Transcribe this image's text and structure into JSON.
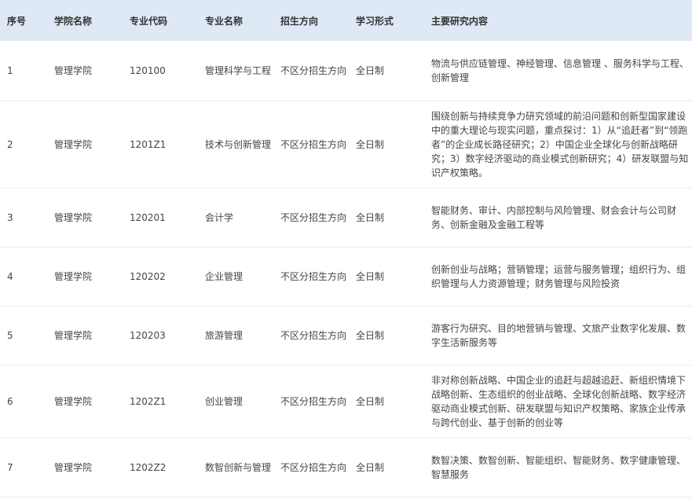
{
  "table": {
    "headers": [
      "序号",
      "学院名称",
      "专业代码",
      "专业名称",
      "招生方向",
      "学习形式",
      "主要研究内容"
    ],
    "rows": [
      [
        "1",
        "管理学院",
        "120100",
        "管理科学与工程",
        "不区分招生方向",
        "全日制",
        "物流与供应链管理、神经管理、信息管理 、服务科学与工程、创新管理"
      ],
      [
        "2",
        "管理学院",
        "1201Z1",
        "技术与创新管理",
        "不区分招生方向",
        "全日制",
        "围绕创新与持续竞争力研究领域的前沿问题和创新型国家建设中的重大理论与现实问题，重点探讨：1）从“追赶者”到“领跑者”的企业成长路径研究；2）中国企业全球化与创新战略研究；3）数字经济驱动的商业模式创新研究；4）研发联盟与知识产权策略。"
      ],
      [
        "3",
        "管理学院",
        "120201",
        "会计学",
        "不区分招生方向",
        "全日制",
        "智能财务、审计、内部控制与风险管理、财会会计与公司财务、创新金融及金融工程等"
      ],
      [
        "4",
        "管理学院",
        "120202",
        "企业管理",
        "不区分招生方向",
        "全日制",
        "创新创业与战略；营销管理；运营与服务管理；组织行为、组织管理与人力资源管理；财务管理与风险投资"
      ],
      [
        "5",
        "管理学院",
        "120203",
        "旅游管理",
        "不区分招生方向",
        "全日制",
        "游客行为研究、目的地营销与管理、文旅产业数字化发展、数字生活新服务等"
      ],
      [
        "6",
        "管理学院",
        "1202Z1",
        "创业管理",
        "不区分招生方向",
        "全日制",
        "非对称创新战略、中国企业的追赶与超越追赶、新组织情境下战略创新、生态组织的创业战略、全球化创新战略、数字经济驱动商业模式创新、研发联盟与知识产权策略、家族企业传承与跨代创业、基于创新的创业等"
      ],
      [
        "7",
        "管理学院",
        "1202Z2",
        "数智创新与管理",
        "不区分招生方向",
        "全日制",
        "数智决策、数智创新、智能组织、智能财务、数字健康管理、智慧服务"
      ]
    ]
  }
}
